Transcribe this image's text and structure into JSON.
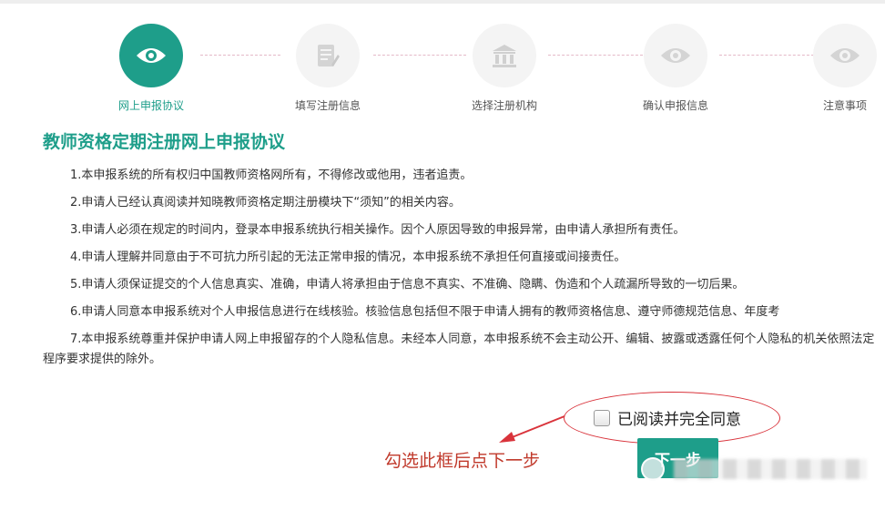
{
  "steps": [
    {
      "label": "网上申报协议",
      "icon": "eye-icon",
      "active": true
    },
    {
      "label": "填写注册信息",
      "icon": "form-icon",
      "active": false
    },
    {
      "label": "选择注册机构",
      "icon": "institution-icon",
      "active": false
    },
    {
      "label": "确认申报信息",
      "icon": "eye-icon",
      "active": false
    },
    {
      "label": "注意事项",
      "icon": "eye-icon",
      "active": false
    }
  ],
  "agreement": {
    "title": "教师资格定期注册网上申报协议",
    "clauses": [
      "1.本申报系统的所有权归中国教师资格网所有，不得修改或他用，违者追责。",
      "2.申请人已经认真阅读并知晓教师资格定期注册模块下“须知”的相关内容。",
      "3.申请人必须在规定的时间内，登录本申报系统执行相关操作。因个人原因导致的申报异常，由申请人承担所有责任。",
      "4.申请人理解并同意由于不可抗力所引起的无法正常申报的情况，本申报系统不承担任何直接或间接责任。",
      "5.申请人须保证提交的个人信息真实、准确，申请人将承担由于信息不真实、不准确、隐瞒、伪造和个人疏漏所导致的一切后果。",
      "6.申请人同意本申报系统对个人申报信息进行在线核验。核验信息包括但不限于申请人拥有的教师资格信息、遵守师德规范信息、年度考",
      "7.本申报系统尊重并保护申请人网上申报留存的个人隐私信息。未经本人同意，本申报系统不会主动公开、编辑、披露或透露任何个人隐私的机关依照法定程序要求提供的除外。"
    ]
  },
  "agree_checkbox": {
    "label": "已阅读并完全同意",
    "checked": false
  },
  "annotation": {
    "hint": "勾选此框后点下一步",
    "color": "#c0392b"
  },
  "next_button": {
    "label": "下一步"
  },
  "colors": {
    "accent": "#1e9e8a",
    "annotation_red": "#d9333b",
    "inactive_circle": "#f4f4f4"
  }
}
